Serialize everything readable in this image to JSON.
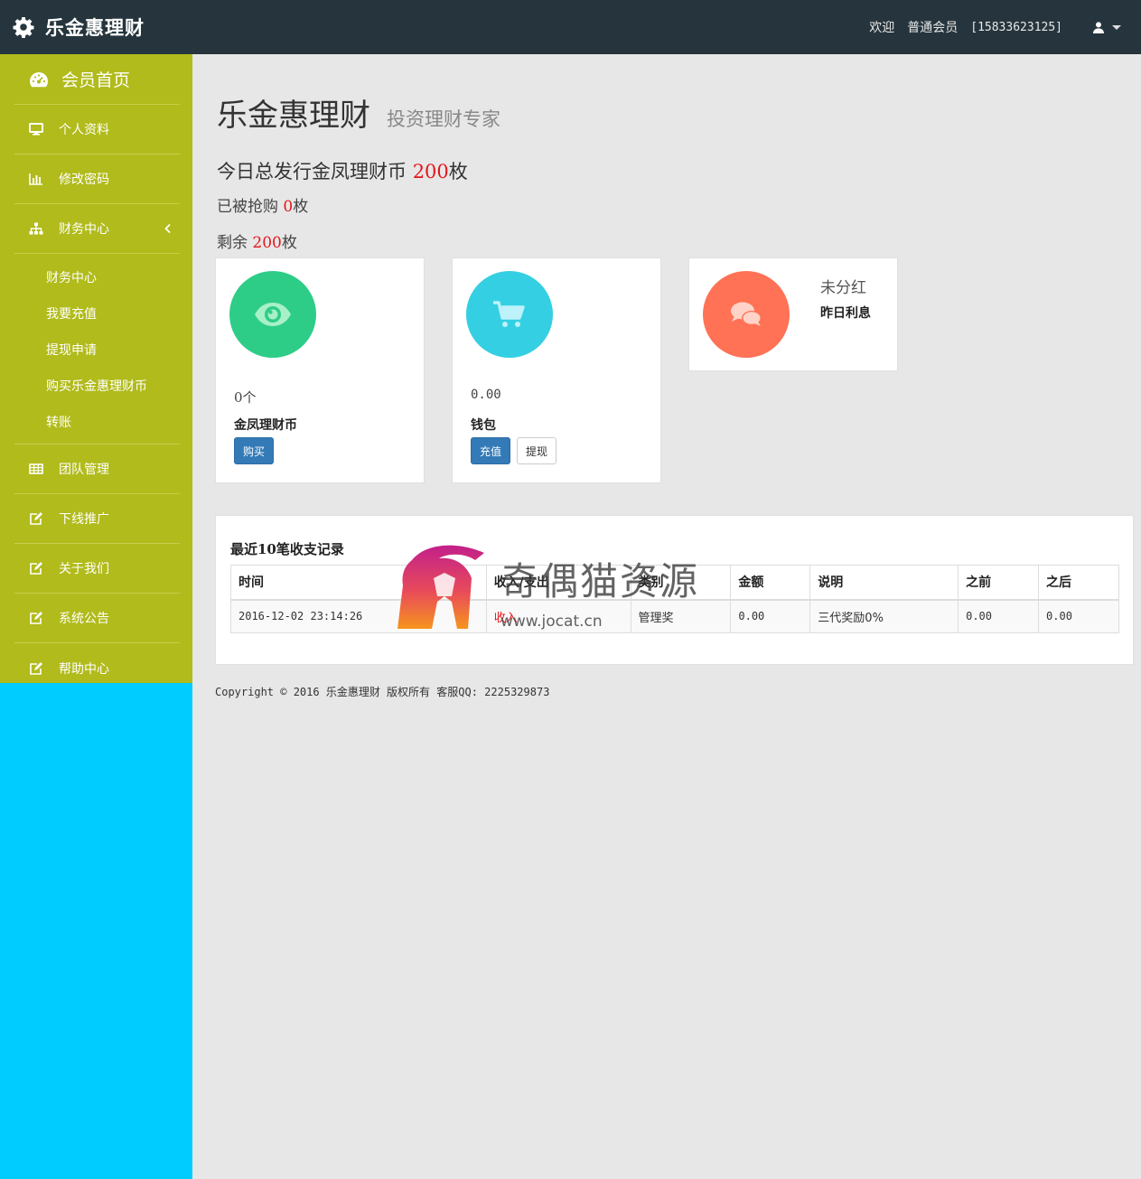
{
  "topbar": {
    "brand": "乐金惠理财",
    "welcome": "欢迎",
    "role": "普通会员",
    "phone": "[15833623125]"
  },
  "sidebar": {
    "home": "会员首页",
    "items": [
      {
        "label": "个人资料",
        "icon": "desktop-icon"
      },
      {
        "label": "修改密码",
        "icon": "bar-chart-icon"
      },
      {
        "label": "财务中心",
        "icon": "sitemap-icon"
      }
    ],
    "finance_sub": [
      "财务中心",
      "我要充值",
      "提现申请",
      "购买乐金惠理财币",
      "转账"
    ],
    "items2": [
      {
        "label": "团队管理",
        "icon": "table-icon"
      },
      {
        "label": "下线推广",
        "icon": "edit-icon"
      },
      {
        "label": "关于我们",
        "icon": "edit-icon"
      },
      {
        "label": "系统公告",
        "icon": "edit-icon"
      },
      {
        "label": "帮助中心",
        "icon": "edit-icon"
      }
    ],
    "colors": {
      "menu": "#b1bb1b",
      "below": "#00ccff"
    }
  },
  "header": {
    "title": "乐金惠理财",
    "subtitle": "投资理财专家"
  },
  "stats": {
    "issued_prefix": "今日总发行金凤理财币 ",
    "issued_value": "200",
    "issued_unit": "枚",
    "sold_prefix": "已被抢购 ",
    "sold_value": "0",
    "sold_unit": "枚",
    "left_prefix": "剩余 ",
    "left_value": "200",
    "left_unit": "枚"
  },
  "cards": {
    "coin": {
      "value": "0个",
      "label": "金凤理财币",
      "buy": "购买",
      "color": "#2ecd87",
      "icon": "eye-icon"
    },
    "wallet": {
      "value": "0.00",
      "label": "钱包",
      "recharge": "充值",
      "withdraw": "提现",
      "color": "#34cfe3",
      "icon": "cart-icon"
    },
    "dividend": {
      "value": "未分红",
      "label": "昨日利息",
      "color": "#ff7255",
      "icon": "comments-icon"
    }
  },
  "records": {
    "title": "最近10笔收支记录",
    "columns": [
      "时间",
      "收入/支出",
      "类别",
      "金额",
      "说明",
      "之前",
      "之后"
    ],
    "rows": [
      [
        "2016-12-02 23:14:26",
        "收入",
        "管理奖",
        "0.00",
        "三代奖励0%",
        "0.00",
        "0.00"
      ]
    ]
  },
  "footer": "Copyright © 2016 乐金惠理财 版权所有 客服QQ: 2225329873",
  "watermark": {
    "text": "奇偶猫资源",
    "url": "www.jocat.cn"
  }
}
